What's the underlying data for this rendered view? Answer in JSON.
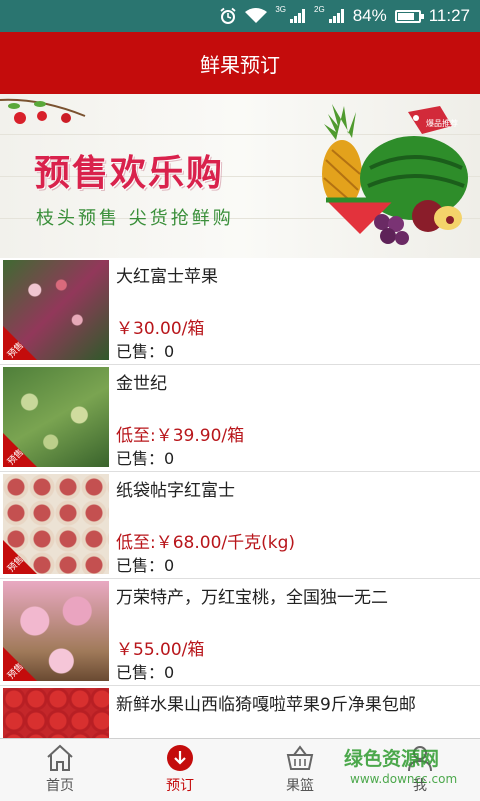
{
  "status_bar": {
    "net_3g": "3G",
    "net_2g": "2G",
    "battery": "84%",
    "battery_level": 0.84,
    "time": "11:27",
    "icons": [
      "alarm-icon",
      "wifi-icon",
      "signal-3g-icon",
      "signal-2g-icon",
      "battery-icon"
    ]
  },
  "app_bar": {
    "title": "鲜果预订"
  },
  "banner": {
    "headline": "预售欢乐购",
    "subline": "枝头预售 尖货抢鲜购",
    "tag_text": "爆品推荐"
  },
  "products": [
    {
      "name": "大红富士苹果",
      "price": "￥30.00/箱",
      "sold": "已售：0",
      "badge": "预售"
    },
    {
      "name": "金世纪",
      "price": "低至:￥39.90/箱",
      "sold": "已售：0",
      "badge": "预售"
    },
    {
      "name": "纸袋帖字红富士",
      "price": "低至:￥68.00/千克(kg)",
      "sold": "已售：0",
      "badge": "预售"
    },
    {
      "name": "万荣特产，万红宝桃，全国独一无二",
      "price": "￥55.00/箱",
      "sold": "已售：0",
      "badge": "预售"
    },
    {
      "name": "新鲜水果山西临猗嘎啦苹果9斤净果包邮",
      "price": "",
      "sold": "",
      "badge": ""
    }
  ],
  "tabbar": {
    "tabs": [
      {
        "label": "首页",
        "icon": "home-icon"
      },
      {
        "label": "预订",
        "icon": "order-icon",
        "active": true
      },
      {
        "label": "果篮",
        "icon": "basket-icon"
      },
      {
        "label": "我",
        "icon": "user-icon"
      }
    ]
  },
  "watermark": {
    "text": "绿色资源网",
    "url": "www.downcc.com"
  },
  "colors": {
    "primary": "#c40c0c",
    "status_bar": "#2a7570",
    "price": "#b8161b",
    "tab_active": "#c40c0c"
  }
}
